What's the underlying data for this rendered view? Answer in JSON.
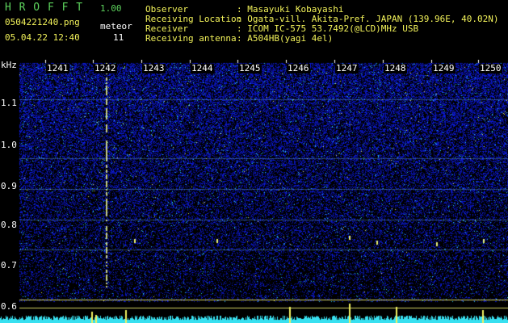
{
  "app": {
    "title": "H R O F F T",
    "version": "1.00"
  },
  "file": {
    "name": "0504221240.png",
    "date_time": "05.04.22 12:40"
  },
  "meteor": {
    "label": "meteor",
    "count": "11"
  },
  "info": [
    {
      "label": "Observer",
      "value": ": Masayuki Kobayashi"
    },
    {
      "label": "Receiving Location",
      "value": ": Ogata-vill. Akita-Pref. JAPAN (139.96E, 40.02N)"
    },
    {
      "label": "Receiver",
      "value": ": ICOM IC-575 53.7492(@LCD)MHz USB"
    },
    {
      "label": "Receiving antenna",
      "value": ": A504HB(yagi 4el)"
    }
  ],
  "axis": {
    "unit": "kHz",
    "freq_ticks": [
      "1.1",
      "1.0",
      "0.9",
      "0.8",
      "0.7",
      "0.6"
    ],
    "minute_ticks": [
      "1241",
      "1242",
      "1243",
      "1244",
      "1245",
      "1246",
      "1247",
      "1248",
      "1249",
      "1250"
    ]
  },
  "colors": {
    "background": "#000000",
    "spectrum_noise": "#1a33c8",
    "meteor_trace": "#f0f060",
    "baseline": "#38e0f0"
  }
}
